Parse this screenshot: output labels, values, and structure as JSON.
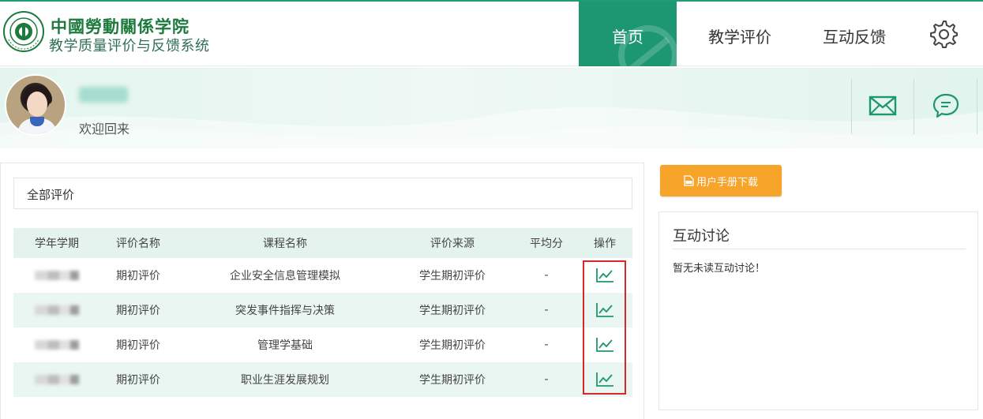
{
  "colors": {
    "primary": "#1d9672",
    "accent_orange": "#f7a52a",
    "highlight_red": "#d8272a",
    "row_alt": "#e9f6f1"
  },
  "header": {
    "school_name": "中國勞動關係学院",
    "system_name": "教学质量评价与反馈系统",
    "nav": {
      "home": "首页",
      "evaluation": "教学评价",
      "feedback": "互动反馈"
    },
    "settings_icon": "gear-icon"
  },
  "user": {
    "welcome": "欢迎回来",
    "mail_icon": "mail-icon",
    "chat_icon": "chat-bubble-icon"
  },
  "evaluations": {
    "filter_label": "全部评价",
    "columns": [
      "学年学期",
      "评价名称",
      "课程名称",
      "评价来源",
      "平均分",
      "操作"
    ],
    "rows": [
      {
        "eval_name": "期初评价",
        "course": "企业安全信息管理模拟",
        "source": "学生期初评价",
        "avg": "-"
      },
      {
        "eval_name": "期初评价",
        "course": "突发事件指挥与决策",
        "source": "学生期初评价",
        "avg": "-"
      },
      {
        "eval_name": "期初评价",
        "course": "管理学基础",
        "source": "学生期初评价",
        "avg": "-"
      },
      {
        "eval_name": "期初评价",
        "course": "职业生涯发展规划",
        "source": "学生期初评价",
        "avg": "-"
      }
    ],
    "action_icon": "trend-chart-icon"
  },
  "sidebar": {
    "manual_button": "用户手册下载",
    "discussion_title": "互动讨论",
    "discussion_empty": "暂无未读互动讨论！"
  }
}
